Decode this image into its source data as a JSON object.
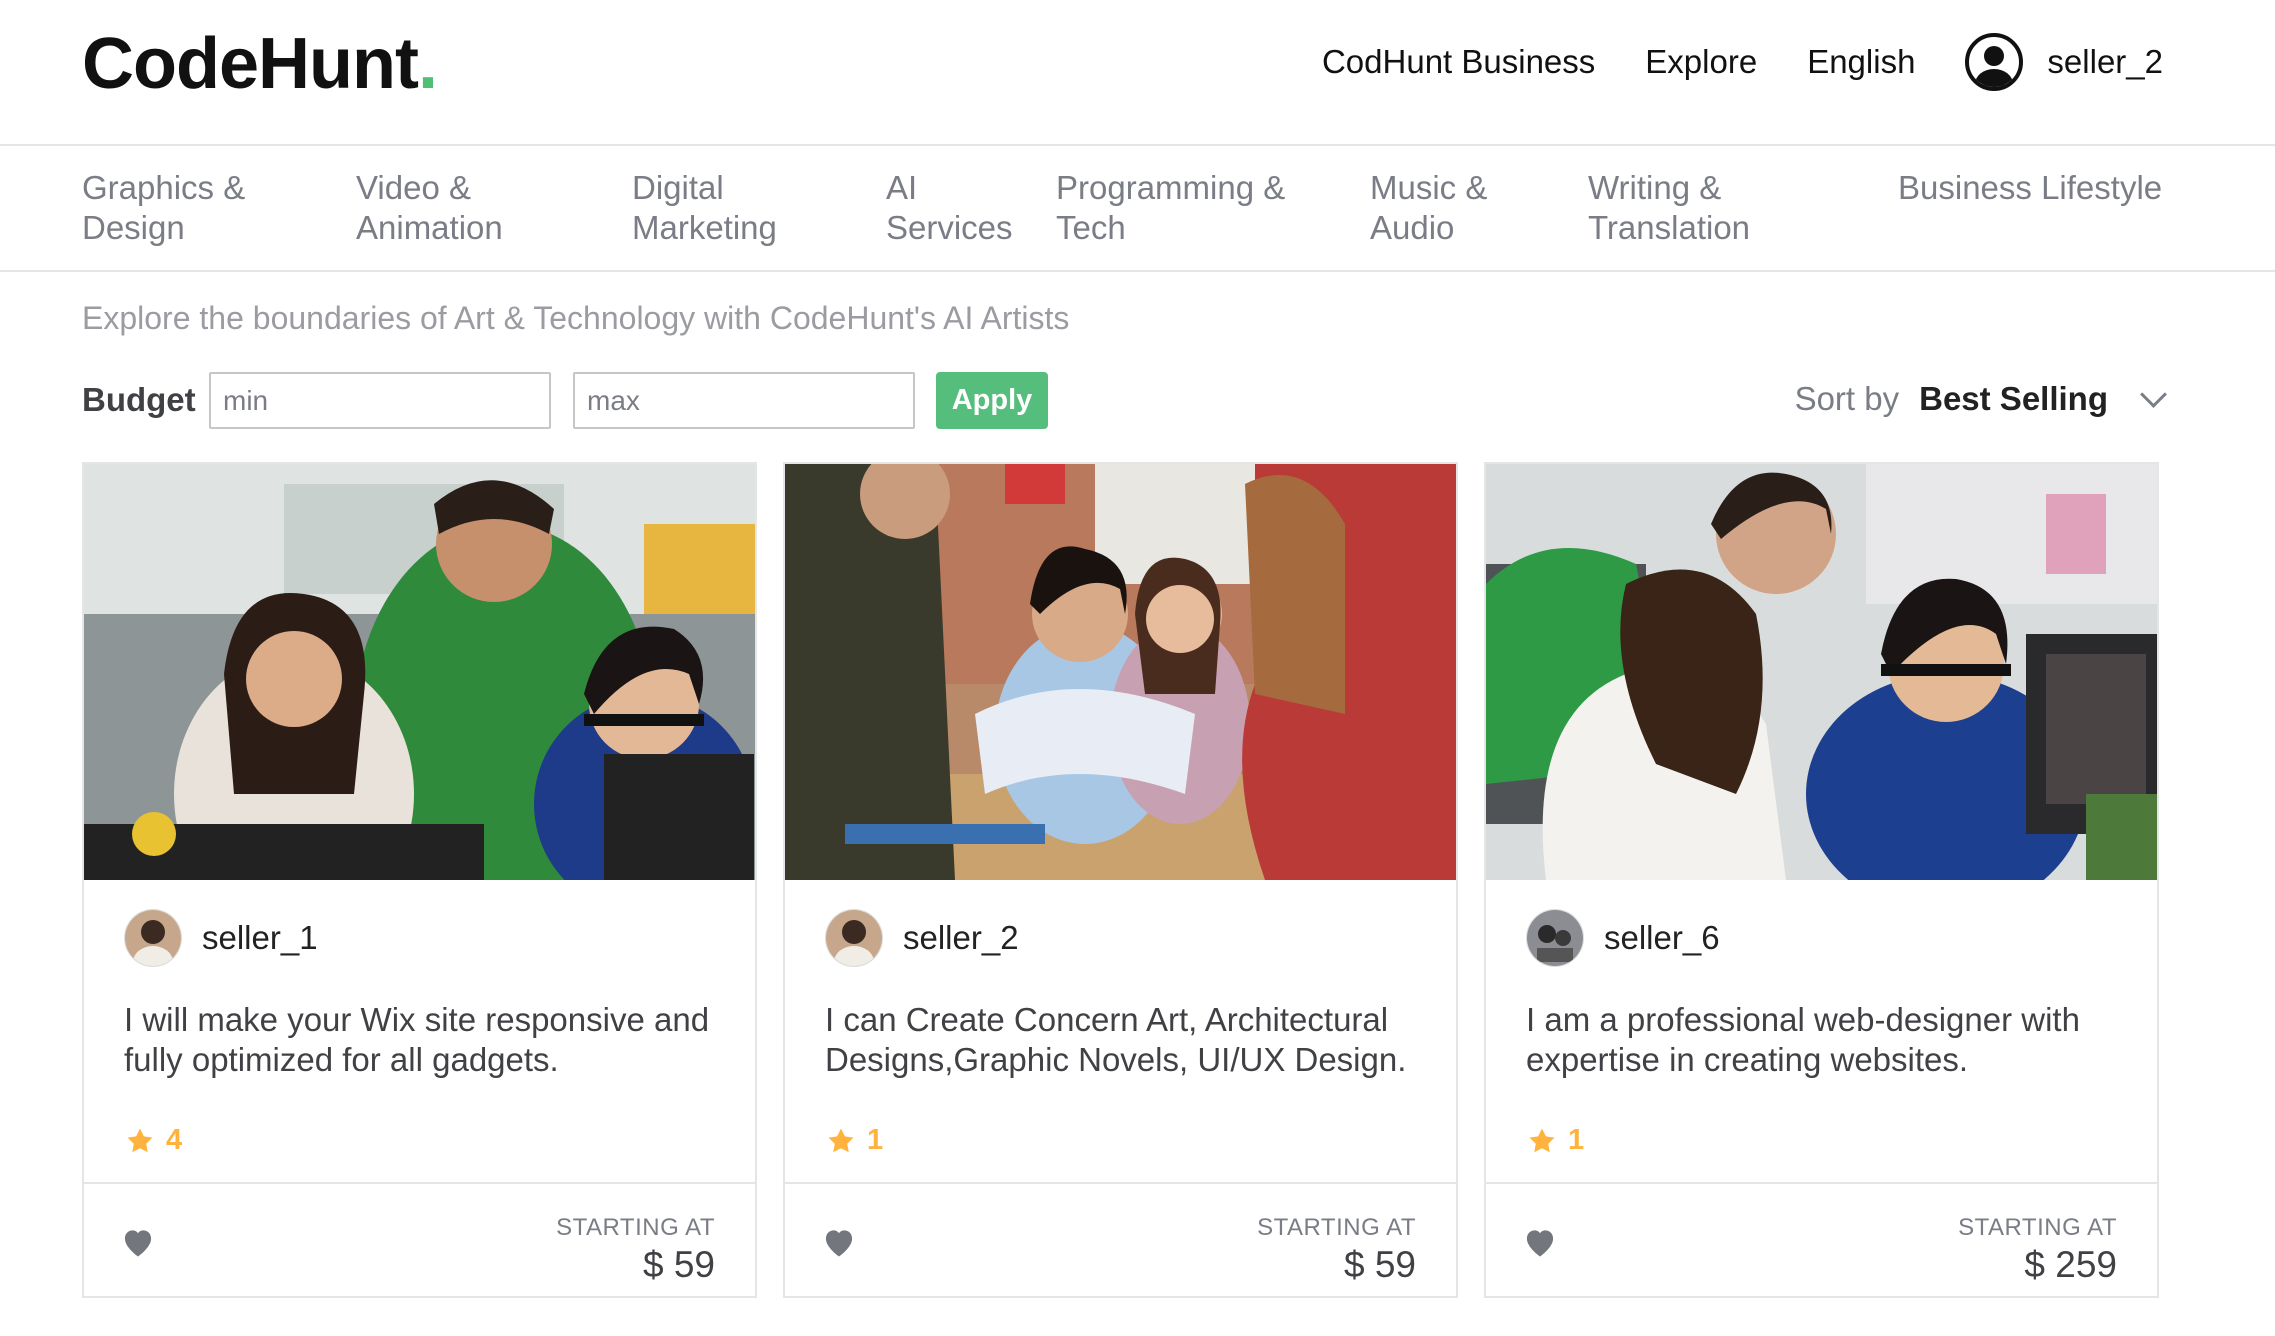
{
  "header": {
    "logo_text": "CodeHunt",
    "logo_dot": ".",
    "nav": {
      "business": "CodHunt Business",
      "explore": "Explore",
      "language": "English",
      "username": "seller_2"
    }
  },
  "categories": [
    {
      "line1": "Graphics &",
      "line2": "Design"
    },
    {
      "line1": "Video &",
      "line2": "Animation"
    },
    {
      "line1": "Digital",
      "line2": "Marketing"
    },
    {
      "line1": "AI",
      "line2": "Services"
    },
    {
      "line1": "Programming &",
      "line2": "Tech"
    },
    {
      "line1": "Music &",
      "line2": "Audio"
    },
    {
      "line1": "Writing &",
      "line2": "Translation"
    },
    {
      "line1": "Business Lifestyle",
      "line2": ""
    }
  ],
  "subtitle": "Explore the boundaries of Art & Technology with CodeHunt's AI Artists",
  "filters": {
    "budget_label": "Budget",
    "min_placeholder": "min",
    "max_placeholder": "max",
    "apply_label": "Apply",
    "sort_label": "Sort by",
    "sort_value": "Best Selling"
  },
  "gigs": [
    {
      "seller": "seller_1",
      "description": "I will make your Wix site responsive and fully optimized for all gadgets.",
      "rating": "4",
      "starting_label": "STARTING AT",
      "price": "$ 59"
    },
    {
      "seller": "seller_2",
      "description": "I can Create Concern Art, Architectural Designs,Graphic Novels, UI/UX Design.",
      "rating": "1",
      "starting_label": "STARTING AT",
      "price": "$ 59"
    },
    {
      "seller": "seller_6",
      "description": "I am a professional web-designer with expertise in creating websites.",
      "rating": "1",
      "starting_label": "STARTING AT",
      "price": "$ 259"
    }
  ],
  "colors": {
    "brand_green": "#4fbf74",
    "apply_green": "#56be7c",
    "star_yellow": "#ffb33e",
    "text_grey": "#7a7d85",
    "border": "#e4e5e7"
  },
  "icons": {
    "user": "user-circle-icon",
    "chevron": "chevron-down-icon",
    "star": "star-icon",
    "heart": "heart-icon"
  }
}
